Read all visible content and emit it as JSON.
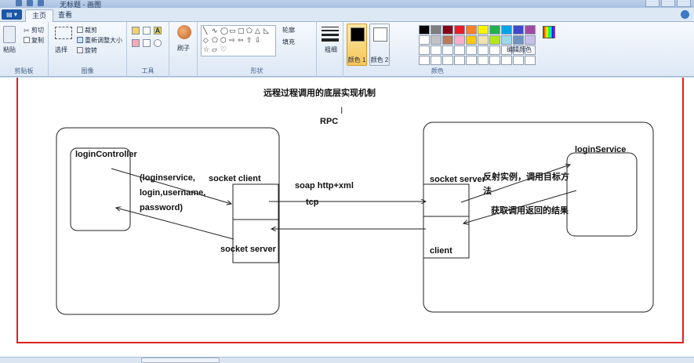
{
  "window": {
    "title": "无标题 - 画图"
  },
  "tabs": [
    {
      "label": "主页",
      "active": true
    },
    {
      "label": "查看",
      "active": false
    }
  ],
  "ribbon": {
    "clipboard": {
      "paste": "粘贴",
      "cut": "剪切",
      "copy": "复制",
      "group": "剪贴板"
    },
    "image": {
      "select": "选择",
      "crop": "裁剪",
      "resize": "重新调整大小",
      "rotate": "旋转",
      "group": "图像"
    },
    "tools": {
      "group": "工具"
    },
    "brushes": {
      "label": "刷子"
    },
    "shapes": {
      "outline": "轮廓",
      "fill": "填充",
      "group": "形状"
    },
    "size": {
      "label": "粗细"
    },
    "colors": {
      "color1": "颜色 1",
      "color2": "颜色 2",
      "edit": "编辑颜色",
      "group": "颜色",
      "color1_value": "#000000",
      "color2_value": "#ffffff",
      "palette": [
        "#000000",
        "#7f7f7f",
        "#880015",
        "#ed1c24",
        "#ff7f27",
        "#fff200",
        "#22b14c",
        "#00a2e8",
        "#3f48cc",
        "#a349a4",
        "#ffffff",
        "#c3c3c3",
        "#b97a57",
        "#ffaec9",
        "#ffc90e",
        "#efe4b0",
        "#b5e61d",
        "#99d9ea",
        "#7092be",
        "#c8bfe7",
        "#ffffff",
        "#ffffff",
        "#ffffff",
        "#ffffff",
        "#ffffff",
        "#ffffff",
        "#ffffff",
        "#ffffff",
        "#ffffff",
        "#ffffff",
        "#ffffff",
        "#ffffff",
        "#ffffff",
        "#ffffff",
        "#ffffff",
        "#ffffff",
        "#ffffff",
        "#ffffff",
        "#ffffff",
        "#ffffff"
      ]
    }
  },
  "diagram": {
    "title": "远程过程调用的底层实现机制",
    "subtitle": "RPC",
    "login_controller": "loginController",
    "call_params_1": "(loginservice,",
    "call_params_2": "login,username,",
    "call_params_3": "password)",
    "socket_client": "socket client",
    "socket_server_left": "socket server",
    "protocol": "soap  http+xml",
    "transport": "tcp",
    "socket_server_right": "socket server",
    "client_right": "client",
    "reflection_1": "反射实例，调用目标方",
    "reflection_2": "法",
    "return_result": "获取调用返回的结果",
    "login_service": "loginService",
    "highlight_color": "#e02020"
  }
}
